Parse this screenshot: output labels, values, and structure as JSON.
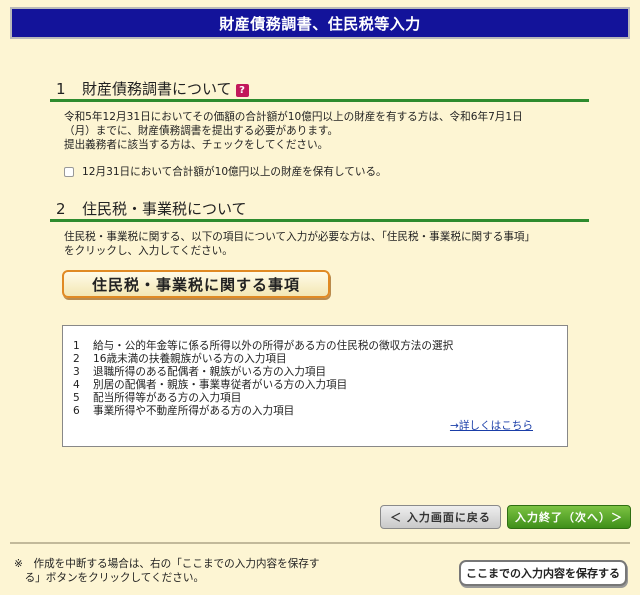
{
  "header": {
    "title": "財産債務調書、住民税等入力"
  },
  "section1": {
    "number": "1",
    "title": "財産債務調書について",
    "help_icon": "?",
    "desc_lines": [
      "令和5年12月31日においてその価額の合計額が10億円以上の財産を有する方は、令和6年7月1日",
      "（月）までに、財産債務調書を提出する必要があります。",
      "提出義務者に該当する方は、チェックをしてください。"
    ],
    "checkbox_label": "12月31日において合計額が10億円以上の財産を保有している。",
    "checkbox_checked": false
  },
  "section2": {
    "number": "2",
    "title": "住民税・事業税について",
    "desc_lines": [
      "住民税・事業税に関する、以下の項目について入力が必要な方は、「住民税・事業税に関する事項」",
      "をクリックし、入力してください。"
    ],
    "button_label": "住民税・事業税に関する事項",
    "items": [
      {
        "n": "1",
        "text": "給与・公的年金等に係る所得以外の所得がある方の住民税の徴収方法の選択"
      },
      {
        "n": "2",
        "text": "16歳未満の扶養親族がいる方の入力項目"
      },
      {
        "n": "3",
        "text": "退職所得のある配偶者・親族がいる方の入力項目"
      },
      {
        "n": "4",
        "text": "別居の配偶者・親族・事業専従者がいる方の入力項目"
      },
      {
        "n": "5",
        "text": "配当所得等がある方の入力項目"
      },
      {
        "n": "6",
        "text": "事業所得や不動産所得がある方の入力項目"
      }
    ],
    "detail_link": "→詳しくはこちら"
  },
  "nav": {
    "back_label": "＜ 入力画面に戻る",
    "next_label": "入力終了（次へ）＞"
  },
  "footer": {
    "note_lines": [
      "※　作成を中断する場合は、右の「ここまでの入力内容を保存す",
      "　る」ボタンをクリックしてください。"
    ],
    "save_label": "ここまでの入力内容を保存する"
  },
  "colors": {
    "header_bg": "#13139a",
    "rule": "#2e8b2e",
    "page_bg": "#fdf5d3",
    "next_button": "#3f8f1a",
    "button_border": "#e08a24",
    "link": "#1a3ea8"
  }
}
